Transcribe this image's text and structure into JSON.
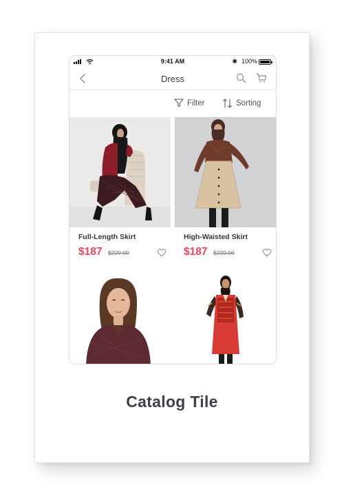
{
  "status_bar": {
    "time": "9:41 AM",
    "bluetooth": "✱",
    "battery_text": "100%"
  },
  "nav": {
    "title": "Dress",
    "back_icon": "chevron-left-icon",
    "search_icon": "search-icon",
    "cart_icon": "cart-icon"
  },
  "toolbar": {
    "filter_label": "Filter",
    "sorting_label": "Sorting"
  },
  "products": [
    {
      "name": "Full-Length Skirt",
      "price": "$187",
      "old_price": "$220.00"
    },
    {
      "name": "High-Waisted Skirt",
      "price": "$187",
      "old_price": "$220.00"
    }
  ],
  "caption": "Catalog Tile",
  "colors": {
    "accent": "#f0445a",
    "text": "#3d3f4a",
    "muted": "#777777"
  }
}
